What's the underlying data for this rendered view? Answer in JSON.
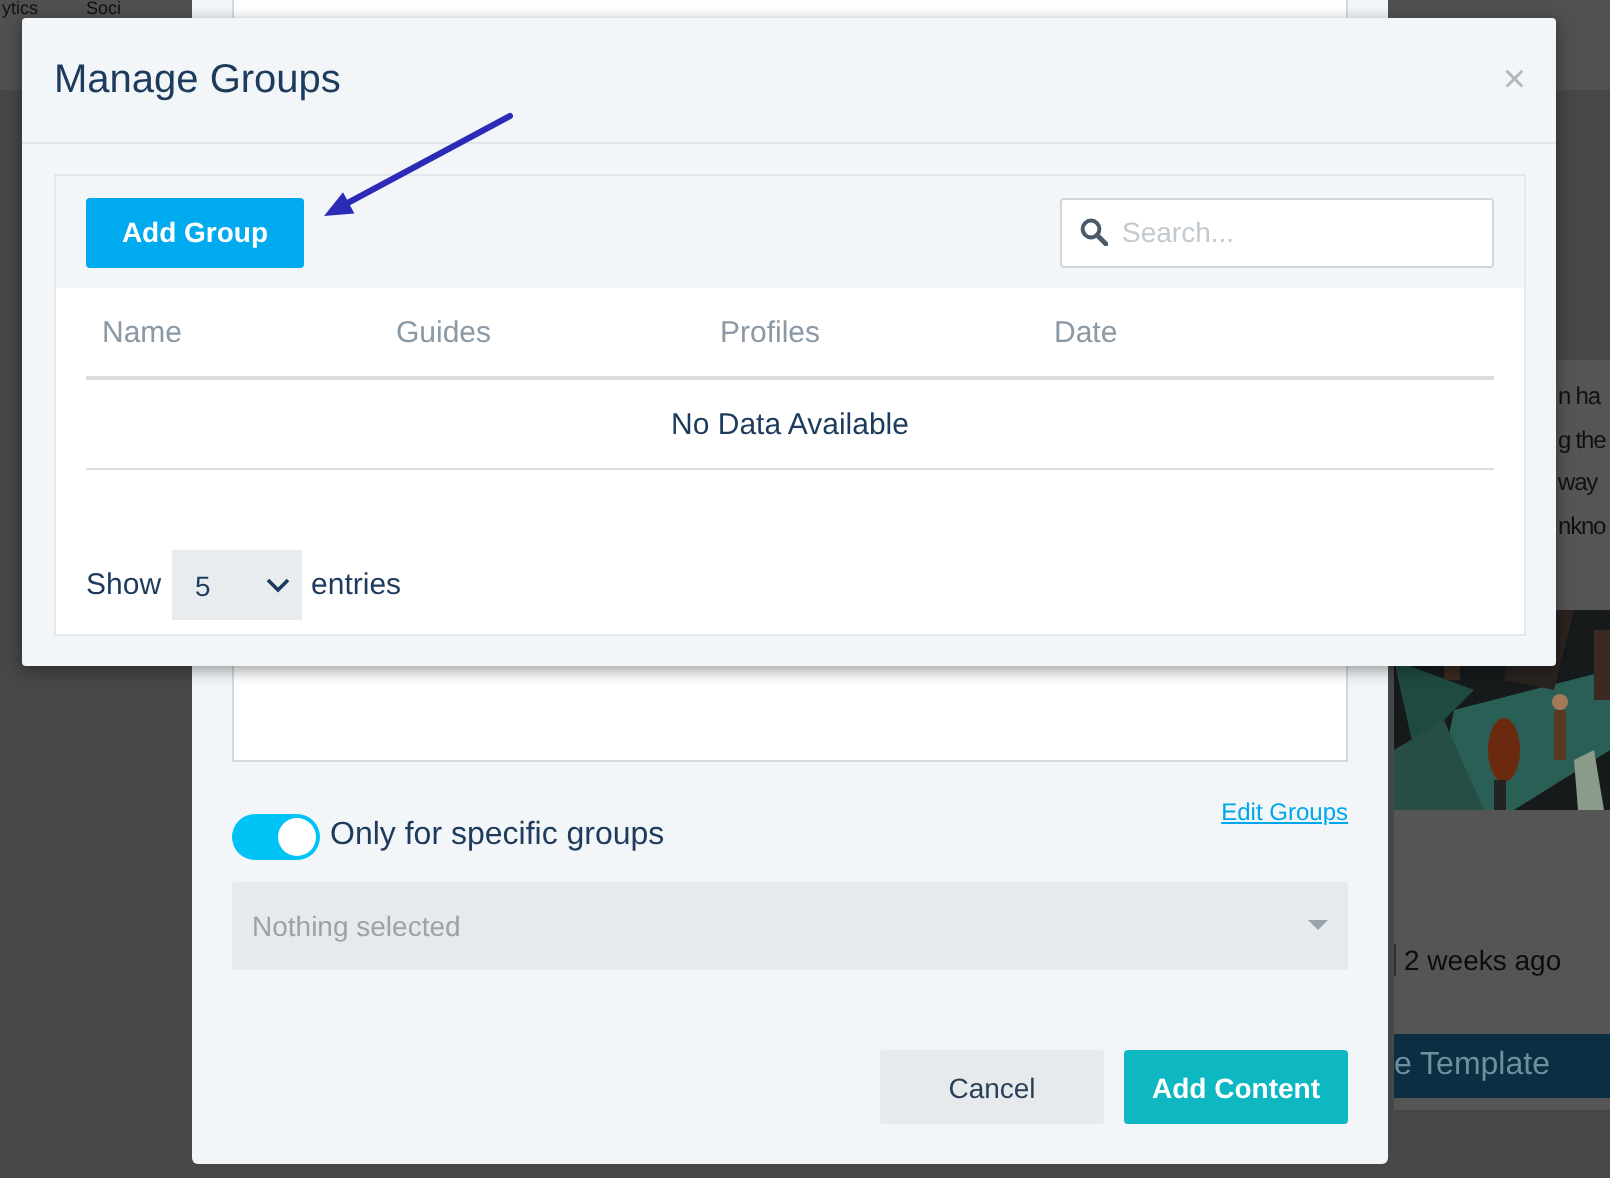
{
  "background": {
    "nav_items": [
      "ytics",
      "Soci"
    ],
    "card_text": [
      "n ha",
      "g the",
      "way",
      "nkno"
    ],
    "card_meta": "2 weeks ago",
    "card_button": "e Template"
  },
  "content_dialog": {
    "toggle": {
      "label": "Only for specific groups",
      "on": true
    },
    "edit_link": "Edit Groups",
    "group_select": {
      "placeholder": "Nothing selected"
    },
    "buttons": [
      {
        "label": "Cancel",
        "kind": "secondary"
      },
      {
        "label": "Add Content",
        "kind": "primary"
      }
    ]
  },
  "groups_dialog": {
    "title": "Manage Groups",
    "close": "×",
    "add_button": "Add Group",
    "search": {
      "placeholder": "Search..."
    },
    "table": {
      "columns": [
        "Name",
        "Guides",
        "Profiles",
        "Date"
      ],
      "empty_text": "No Data Available"
    },
    "length": {
      "label_before": "Show",
      "value": "5",
      "label_after": "entries"
    }
  }
}
